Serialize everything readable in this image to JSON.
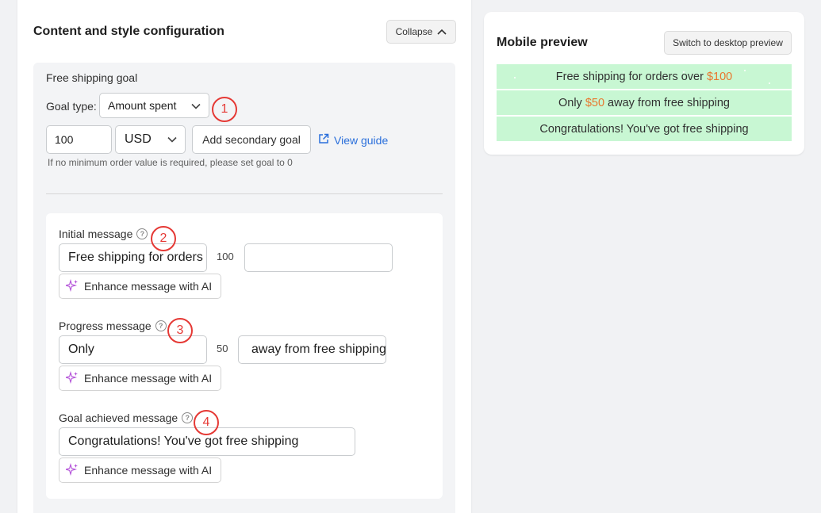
{
  "config": {
    "title": "Content and style configuration",
    "collapse_label": "Collapse",
    "goal_section": {
      "title": "Free shipping goal",
      "goal_type_label": "Goal type:",
      "goal_type_value": "Amount spent",
      "amount_value": "100",
      "currency_value": "USD",
      "secondary_goal_label": "Add secondary goal",
      "view_guide_label": "View guide",
      "hint": "If no minimum order value is required, please set goal to 0"
    },
    "messages": {
      "initial": {
        "label": "Initial message",
        "prefix_value": "Free shipping for orders over",
        "amount": "100",
        "suffix_value": "",
        "ai_label": "Enhance message with AI"
      },
      "progress": {
        "label": "Progress message",
        "prefix_value": "Only",
        "amount": "50",
        "suffix_value": "away from free shipping",
        "ai_label": "Enhance message with AI"
      },
      "achieved": {
        "label": "Goal achieved message",
        "value": "Congratulations! You've got free shipping",
        "ai_label": "Enhance message with AI"
      }
    }
  },
  "preview": {
    "title": "Mobile preview",
    "switch_label": "Switch to desktop preview",
    "bars": [
      {
        "text_before": "Free shipping for orders over ",
        "amount": "$100",
        "text_after": ""
      },
      {
        "text_before": "Only ",
        "amount": "$50",
        "text_after": " away from free shipping"
      },
      {
        "text_before": "Congratulations! You've got free shipping",
        "amount": "",
        "text_after": ""
      }
    ]
  },
  "markers": [
    "1",
    "2",
    "3",
    "4"
  ],
  "colors": {
    "accent": "#e8772e",
    "bar_background": "#c8f7d3",
    "marker": "#e53935",
    "link": "#2a6fdb"
  },
  "icons": {
    "collapse": "chevron-up-icon",
    "select": "chevron-down-icon",
    "guide": "external-link-icon",
    "ai": "sparkles-icon",
    "help": "question-circle-icon"
  }
}
